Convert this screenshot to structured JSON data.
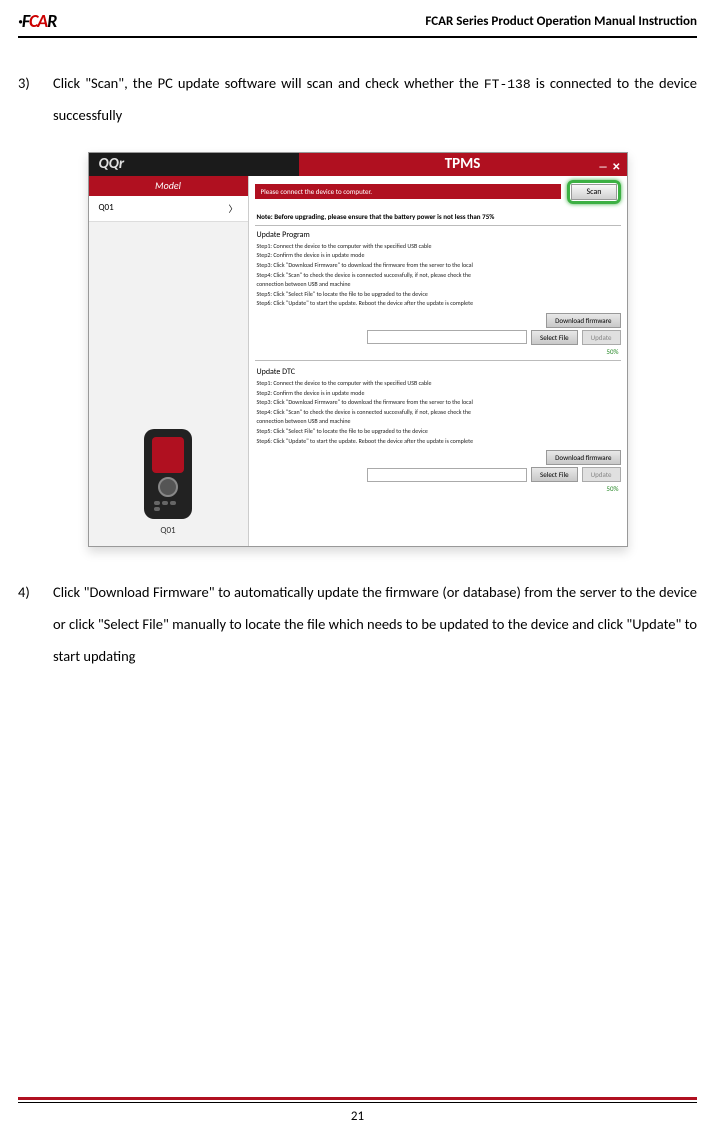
{
  "header": {
    "logo_f": "·F",
    "logo_ca": "CA",
    "logo_r": "R",
    "title": "FCAR Series Product  Operation Manual Instruction"
  },
  "step3": {
    "num": "3)",
    "text_a": "Click \"Scan\", the PC update software will scan and check whether the ",
    "model": "FT-138",
    "text_b": " is connected to the device successfully"
  },
  "app": {
    "qqr": "QQr",
    "tpms": "TPMS",
    "minimize": "—",
    "close": "✕",
    "model_tab": "Model",
    "sidebar_item": "Q01",
    "chevron": "〉",
    "device_label": "Q01",
    "warn_text": "Please connect the device to computer.",
    "scan_label": "Scan",
    "note": "Note: Before upgrading, please ensure that the battery power is not less than 75%",
    "program_title": "Update Program",
    "dtc_title": "Update DTC",
    "steps": {
      "s1": "Step1: Connect the device to the computer with the specified USB cable",
      "s2": "Step2: Confirm the device is in update mode",
      "s3": "Step3: Click \"Download Firmware\" to download the firmware from the server to the local",
      "s4": "Step4: Click \"Scan\" to check the device is connected successfully, if not, please check the",
      "s4b": "connection between USB and machine",
      "s5": "Step5: Click \"Select File\" to locate the file to be upgraded to the device",
      "s6": "Step6: Click \"Update\" to start the update. Reboot the device after the update is complete"
    },
    "download_btn": "Download firmware",
    "select_btn": "Select File",
    "update_btn": "Update",
    "percent": "50%"
  },
  "step4": {
    "num": "4)",
    "text": "Click \"Download Firmware\" to automatically update the firmware (or database) from the server to the device or click \"Select File\" manually to locate the file which needs to be updated to the device and click \"Update\" to start updating"
  },
  "page_number": "21"
}
